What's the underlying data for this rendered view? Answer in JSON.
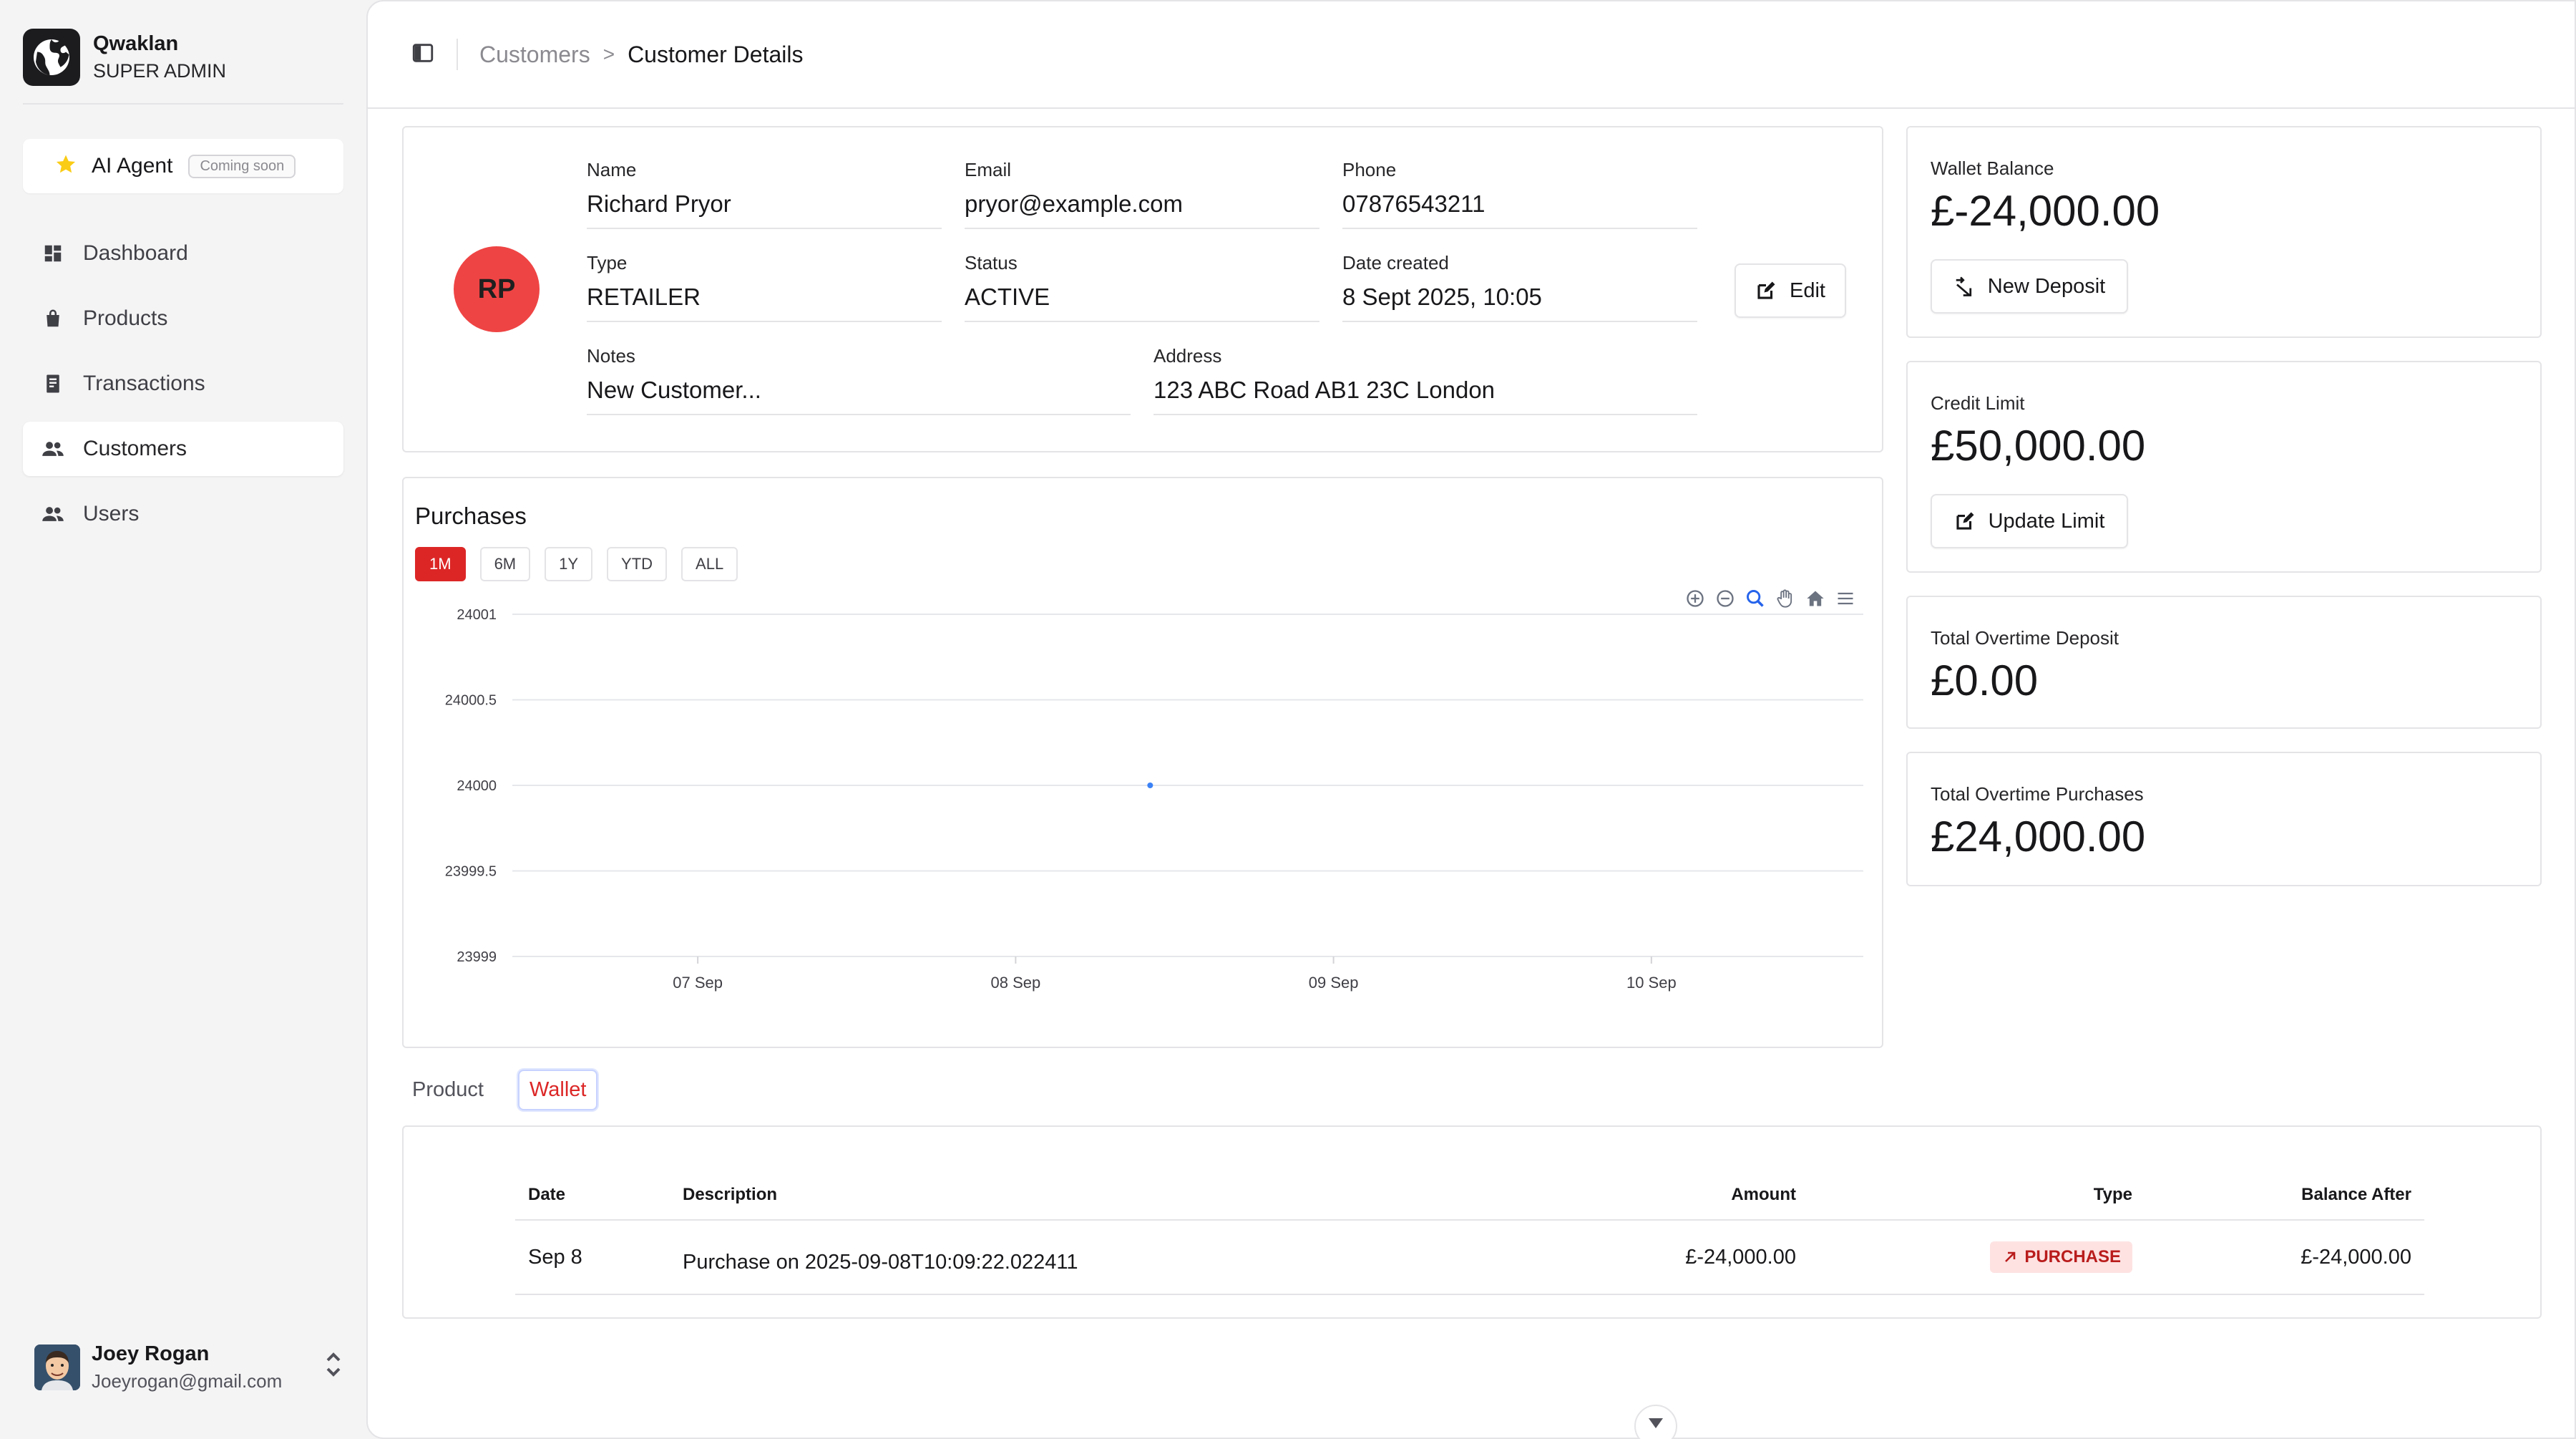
{
  "app": {
    "name": "Qwaklan",
    "role": "SUPER ADMIN"
  },
  "ai_agent": {
    "label": "AI Agent",
    "badge": "Coming soon"
  },
  "nav": [
    {
      "label": "Dashboard",
      "icon": "dashboard-icon"
    },
    {
      "label": "Products",
      "icon": "shopping-bag-icon"
    },
    {
      "label": "Transactions",
      "icon": "receipt-icon"
    },
    {
      "label": "Customers",
      "icon": "users-icon",
      "active": true
    },
    {
      "label": "Users",
      "icon": "users-icon"
    }
  ],
  "user": {
    "name": "Joey Rogan",
    "email": "Joeyrogan@gmail.com"
  },
  "breadcrumb": {
    "parent": "Customers",
    "separator": ">",
    "current": "Customer Details"
  },
  "customer": {
    "initials": "RP",
    "name_label": "Name",
    "name": "Richard Pryor",
    "email_label": "Email",
    "email": "pryor@example.com",
    "phone_label": "Phone",
    "phone": "07876543211",
    "type_label": "Type",
    "type": "RETAILER",
    "status_label": "Status",
    "status": "ACTIVE",
    "date_label": "Date created",
    "date": "8 Sept 2025, 10:05",
    "notes_label": "Notes",
    "notes": "New Customer...",
    "address_label": "Address",
    "address": "123 ABC Road AB1 23C London",
    "edit_label": "Edit"
  },
  "stats": {
    "wallet_label": "Wallet Balance",
    "wallet_value": "£-24,000.00",
    "deposit_button": "New Deposit",
    "credit_label": "Credit Limit",
    "credit_value": "£50,000.00",
    "limit_button": "Update Limit",
    "deposit_total_label": "Total Overtime Deposit",
    "deposit_total_value": "£0.00",
    "purchases_total_label": "Total Overtime Purchases",
    "purchases_total_value": "£24,000.00"
  },
  "purchases": {
    "title": "Purchases",
    "ranges": [
      "1M",
      "6M",
      "1Y",
      "YTD",
      "ALL"
    ],
    "active_range": "1M"
  },
  "chart_data": {
    "type": "scatter",
    "title": "Purchases",
    "x_ticks": [
      "07 Sep",
      "08 Sep",
      "09 Sep",
      "10 Sep"
    ],
    "y_ticks": [
      "24001",
      "24000.5",
      "24000",
      "23999.5",
      "23999"
    ],
    "ylim": [
      23999,
      24001
    ],
    "series": [
      {
        "x": [
          "2025-09-08T10:09:22"
        ],
        "y": [
          24000
        ]
      }
    ],
    "grid": true,
    "color": "#3b82f6"
  },
  "tabs": {
    "product": "Product",
    "wallet": "Wallet",
    "active": "Wallet"
  },
  "table": {
    "headers": [
      "Date",
      "Description",
      "Amount",
      "Type",
      "Balance After"
    ],
    "rows": [
      {
        "date": "Sep 8",
        "description": "Purchase on 2025-09-08T10:09:22.022411",
        "amount": "£-24,000.00",
        "type": "PURCHASE",
        "balance": "£-24,000.00"
      }
    ]
  },
  "colors": {
    "accent": "#dc2626",
    "avatar": "#ef4444",
    "badge_bg": "#fee2e2",
    "point": "#3b82f6"
  }
}
